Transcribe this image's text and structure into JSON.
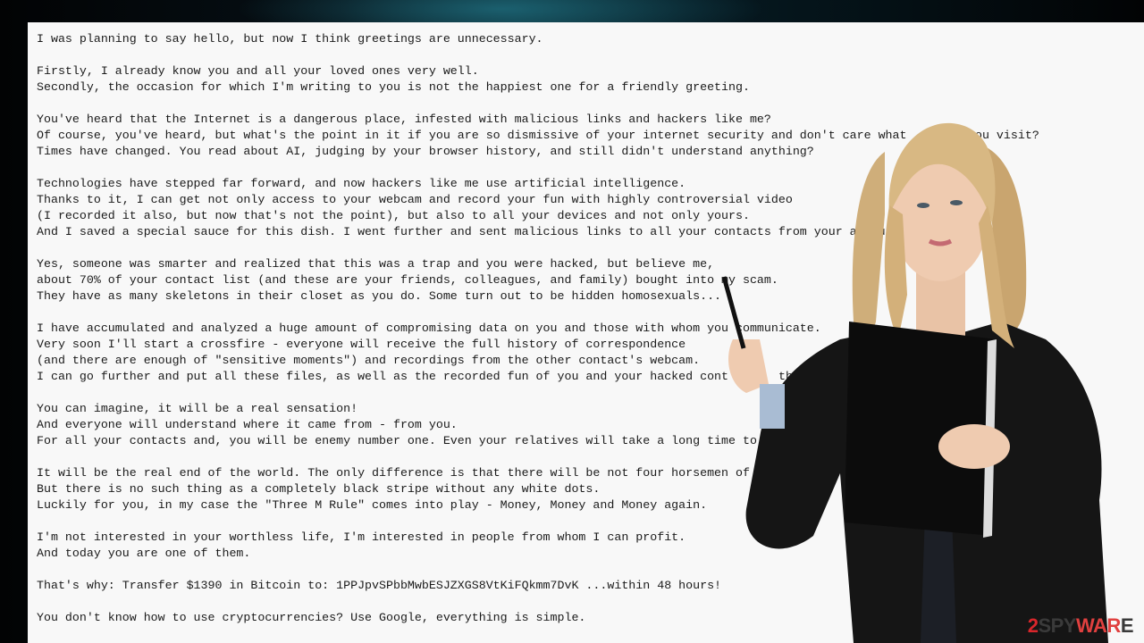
{
  "email": {
    "lines": [
      "I was planning to say hello, but now I think greetings are unnecessary.",
      "",
      "Firstly, I already know you and all your loved ones very well.",
      "Secondly, the occasion for which I'm writing to you is not the happiest one for a friendly greeting.",
      "",
      "You've heard that the Internet is a dangerous place, infested with malicious links and hackers like me?",
      "Of course, you've heard, but what's the point in it if you are so dismissive of your internet security and don't care what",
      "Times have changed. You read about AI, judging by your browser history, and still didn't understand anything?",
      "",
      "Technologies have stepped far forward, and now hackers like me use artificial intelligence.",
      "Thanks to it, I can get not only access to your webcam and record your fun with highly controversial video",
      "(I recorded it also, but now that's not the point), but also to all your devices and not only yours.",
      "And I saved a special sauce for this dish. I went further and sent malicious links to all your contacts from your account",
      "",
      "Yes, someone was smarter and realized that this was a trap and you were hacked, but believe me,",
      "about 70% of your contact list (and these are your friends, colleagues, and family) bought into my scam.",
      "They have as many skeletons in their closet as you do. Some turn out to be hidden homosexuals...",
      "",
      "I have accumulated and analyzed a huge amount of compromising data on you and those with whom you communicate.",
      "Very soon I'll start a crossfire - everyone will receive the full history of correspondence",
      "(and there are enough of \"sensitive moments\") and recordings from the other contact's webcam.",
      "I can go further and put all these files, as well as the recorded fun of you and your hacked cont",
      "",
      "You can imagine, it will be a real sensation!",
      "And everyone will understand where it came from - from you.",
      "For all your contacts and, you will be enemy number one. Even your relatives will take a long time to",
      "",
      "It will be the real end of the world. The only difference is that there will be not four horsemen of the apo",
      "But there is no such thing as a completely black stripe without any white dots.",
      "Luckily for you, in my case the \"Three M Rule\" comes into play - Money, Money and Money again.",
      "",
      "I'm not interested in your worthless life, I'm interested in people from whom I can profit.",
      "And today you are one of them.",
      "",
      "That's why: Transfer $1390 in Bitcoin to: 1PPJpvSPbbMwbESJZXGS8VtKiFQkmm7DvK ...within 48 hours!",
      "",
      "You don't know how to use cryptocurrencies? Use Google, everything is simple."
    ],
    "fragments": {
      "visit": "you visit?",
      "hard": "th \"hard"
    }
  },
  "watermark": {
    "prefix": "2",
    "middle": "SPY",
    "suffix": "WAR",
    "tail": "E"
  },
  "colors": {
    "panel": "#f8f8f8",
    "text": "#1a1a1a",
    "brand_red": "#d9262b"
  }
}
